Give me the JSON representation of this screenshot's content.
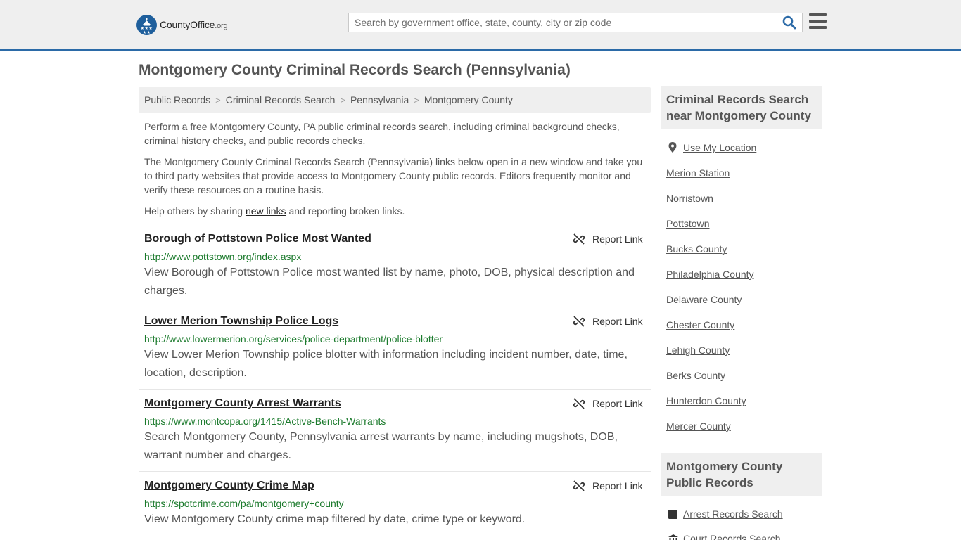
{
  "header": {
    "logo_main": "CountyOffice",
    "logo_tld": ".org",
    "search_placeholder": "Search by government office, state, county, city or zip code"
  },
  "page_title": "Montgomery County Criminal Records Search (Pennsylvania)",
  "breadcrumb": [
    "Public Records",
    "Criminal Records Search",
    "Pennsylvania",
    "Montgomery County"
  ],
  "intro": {
    "p1": "Perform a free Montgomery County, PA public criminal records search, including criminal background checks, criminal history checks, and public records checks.",
    "p2": "The Montgomery County Criminal Records Search (Pennsylvania) links below open in a new window and take you to third party websites that provide access to Montgomery County public records. Editors frequently monitor and verify these resources on a routine basis.",
    "p3_before": "Help others by sharing ",
    "p3_link": "new links",
    "p3_after": " and reporting broken links."
  },
  "report_label": "Report Link",
  "listings": [
    {
      "title": "Borough of Pottstown Police Most Wanted",
      "url": "http://www.pottstown.org/index.aspx",
      "desc": "View Borough of Pottstown Police most wanted list by name, photo, DOB, physical description and charges."
    },
    {
      "title": "Lower Merion Township Police Logs",
      "url": "http://www.lowermerion.org/services/police-department/police-blotter",
      "desc": "View Lower Merion Township police blotter with information including incident number, date, time, location, description."
    },
    {
      "title": "Montgomery County Arrest Warrants",
      "url": "https://www.montcopa.org/1415/Active-Bench-Warrants",
      "desc": "Search Montgomery County, Pennsylvania arrest warrants by name, including mugshots, DOB, warrant number and charges."
    },
    {
      "title": "Montgomery County Crime Map",
      "url": "https://spotcrime.com/pa/montgomery+county",
      "desc": "View Montgomery County crime map filtered by date, crime type or keyword."
    }
  ],
  "sidebar": {
    "nearby_heading": "Criminal Records Search near Montgomery County",
    "use_location": "Use My Location",
    "nearby": [
      "Merion Station",
      "Norristown",
      "Pottstown",
      "Bucks County",
      "Philadelphia County",
      "Delaware County",
      "Chester County",
      "Lehigh County",
      "Berks County",
      "Hunterdon County",
      "Mercer County"
    ],
    "records_heading": "Montgomery County Public Records",
    "records": [
      "Arrest Records Search",
      "Court Records Search"
    ]
  },
  "colors": {
    "accent_blue": "#2b6aa7",
    "url_green": "#1b7a2c",
    "panel_gray": "#efefef"
  }
}
